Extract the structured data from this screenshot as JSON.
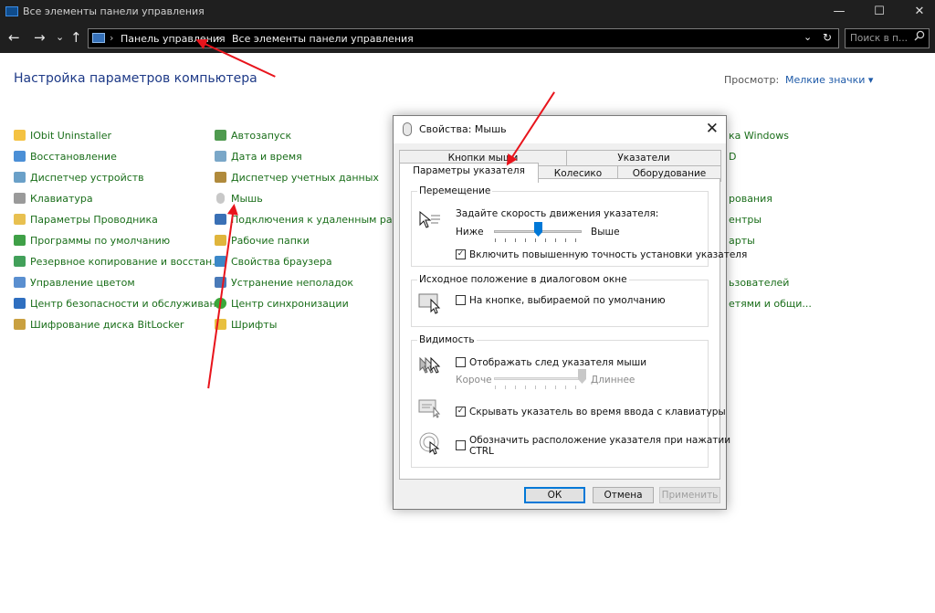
{
  "window": {
    "title": "Все элементы панели управления",
    "minimize": "—",
    "maximize": "☐",
    "close": "✕"
  },
  "nav": {
    "back": "←",
    "forward": "→",
    "recent": "⌄",
    "up": "↑"
  },
  "address": {
    "crumbs": [
      "Панель управления",
      "Все элементы панели управления"
    ],
    "separator": "›",
    "dropdown": "⌄",
    "refresh": "↻"
  },
  "search": {
    "placeholder": "Поиск в п...",
    "icon": "search-icon"
  },
  "heading": "Настройка параметров компьютера",
  "view": {
    "label": "Просмотр:",
    "value": "Мелкие значки ▾"
  },
  "columns": {
    "col1": [
      "IObit Uninstaller",
      "Восстановление",
      "Диспетчер устройств",
      "Клавиатура",
      "Параметры Проводника",
      "Программы по умолчанию",
      "Резервное копирование и восстан...",
      "Управление цветом",
      "Центр безопасности и обслуживан...",
      "Шифрование диска BitLocker"
    ],
    "col2": [
      "Автозапуск",
      "Дата и время",
      "Диспетчер учетных данных",
      "Мышь",
      "Подключения к удаленным рабоч...",
      "Рабочие папки",
      "Свойства браузера",
      "Устранение неполадок",
      "Центр синхронизации",
      "Шрифты"
    ],
    "col3": [
      "ка Windows",
      "D",
      "рования",
      "ентры",
      "арты",
      "ьзователей",
      "етями и общи..."
    ]
  },
  "colors": {
    "link": "#1a6e1a",
    "heading": "#1e3a87",
    "accent": "#0078d7",
    "arrow": "#e8141c"
  },
  "dialog": {
    "title": "Свойства: Мышь",
    "close": "✕",
    "tabs_back": [
      "Кнопки мыши",
      "Указатели"
    ],
    "tabs_front": [
      "Параметры указателя",
      "Колесико",
      "Оборудование"
    ],
    "motion": {
      "group": "Перемещение",
      "prompt": "Задайте скорость движения указателя:",
      "low": "Ниже",
      "high": "Выше",
      "speed_level": 0.5,
      "precision_label": "Включить повышенную точность установки указателя",
      "precision_checked": "✓"
    },
    "snap": {
      "group": "Исходное положение в диалоговом окне",
      "label": "На кнопке, выбираемой по умолчанию",
      "checked": ""
    },
    "visibility": {
      "group": "Видимость",
      "trail_label": "Отображать след указателя мыши",
      "trail_checked": "",
      "short": "Короче",
      "long": "Длиннее",
      "trail_level": 1.0,
      "hide_label": "Скрывать указатель во время ввода с клавиатуры",
      "hide_checked": "✓",
      "ctrl_label_1": "Обозначить расположение указателя при нажатии",
      "ctrl_label_2": "CTRL",
      "ctrl_checked": ""
    },
    "buttons": {
      "ok": "ОК",
      "cancel": "Отмена",
      "apply": "Применить"
    }
  }
}
